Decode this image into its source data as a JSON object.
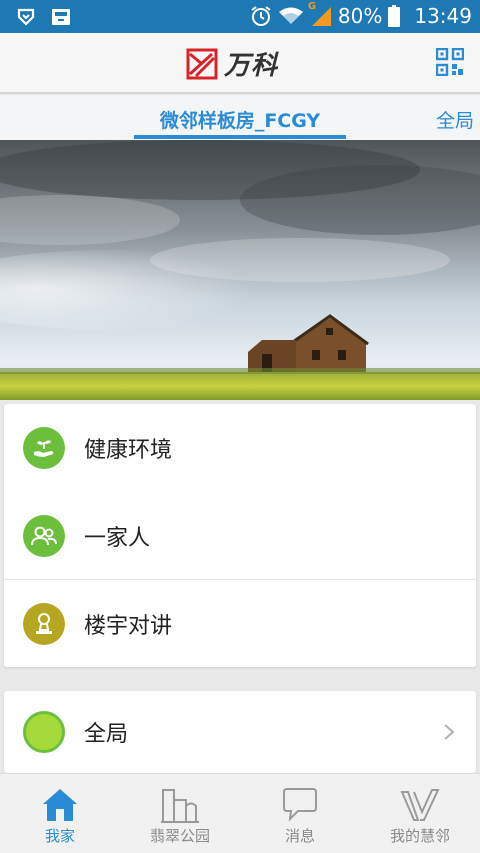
{
  "status_bar": {
    "battery": "80%",
    "time": "13:49",
    "network": "G"
  },
  "header": {
    "logo_text": "万科"
  },
  "tabs": {
    "current": "微邻样板房_FCGY",
    "right": "全局"
  },
  "menu": {
    "items": [
      {
        "label": "健康环境",
        "icon": "plant-hand-icon",
        "color": "#6cbf3c"
      },
      {
        "label": "一家人",
        "icon": "family-icon",
        "color": "#6cbf3c"
      },
      {
        "label": "楼宇对讲",
        "icon": "intercom-icon",
        "color": "#b6a722"
      }
    ]
  },
  "global_row": {
    "label": "全局",
    "color": "#a6d93a"
  },
  "bottom_nav": {
    "items": [
      {
        "label": "我家",
        "icon": "home-icon",
        "active": true
      },
      {
        "label": "翡翠公园",
        "icon": "buildings-icon",
        "active": false
      },
      {
        "label": "消息",
        "icon": "chat-bubble-icon",
        "active": false
      },
      {
        "label": "我的慧邻",
        "icon": "v-logo-icon",
        "active": false
      }
    ]
  },
  "colors": {
    "status_bar": "#1e78b4",
    "accent": "#2a8bd6",
    "brand_red": "#d8232a"
  }
}
